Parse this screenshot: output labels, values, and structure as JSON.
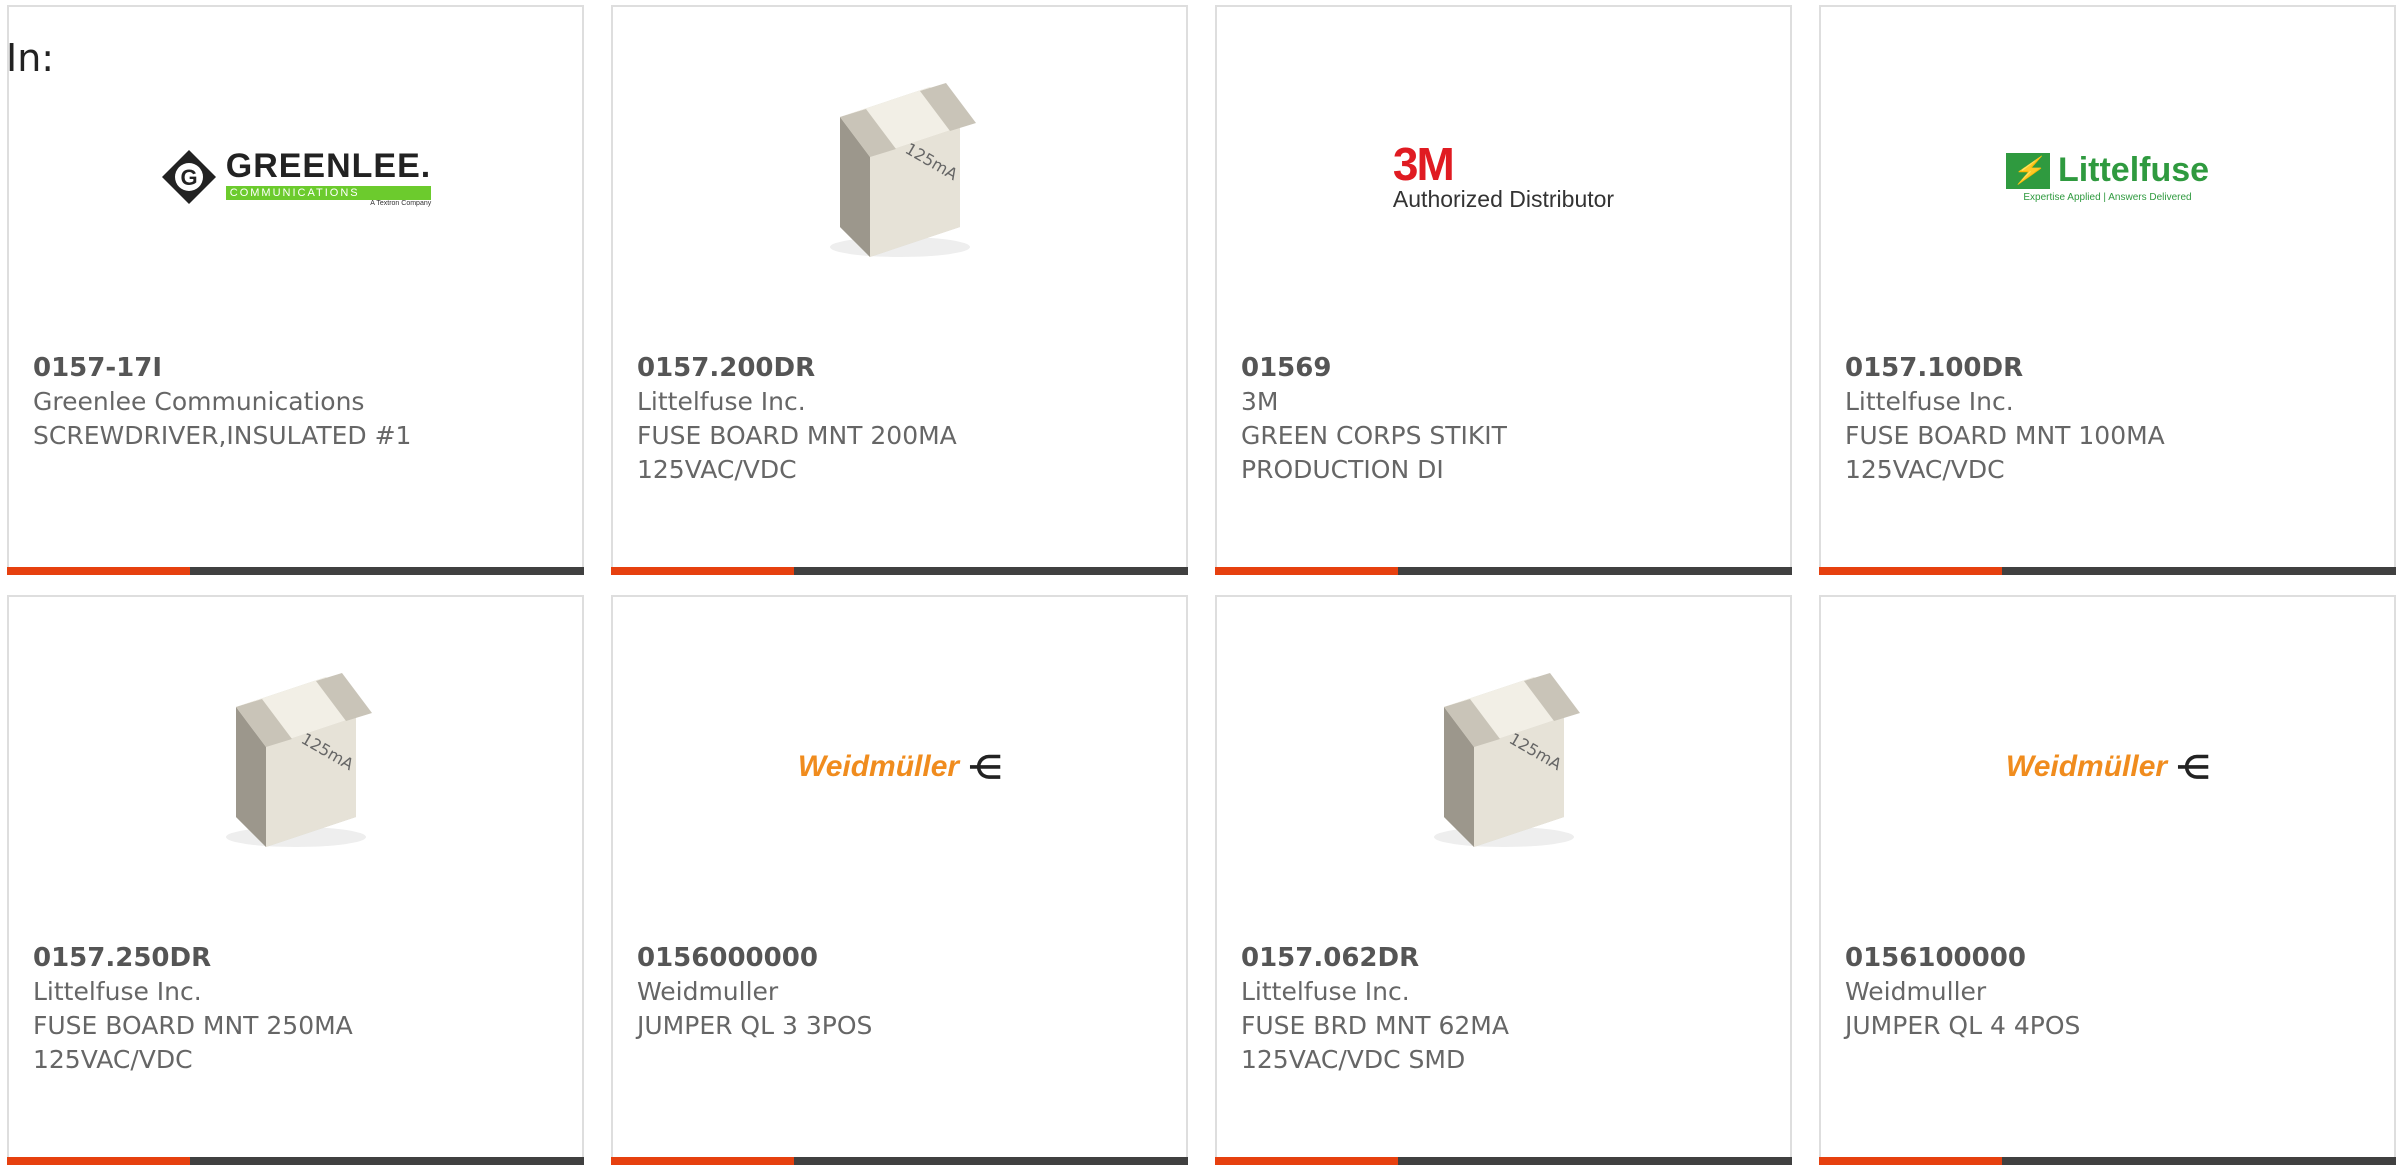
{
  "page": {
    "in_label": "In:"
  },
  "colors": {
    "accent": "#e6400f",
    "bar": "#404040",
    "border": "#dedede"
  },
  "products": [
    {
      "part": "0157-17I",
      "manufacturer": "Greenlee Communications",
      "desc1": "SCREWDRIVER,INSULATED #1",
      "desc2": "",
      "image": "greenlee-logo",
      "logo": {
        "name": "GREENLEE.",
        "sub": "COMMUNICATIONS",
        "small": "A Textron Company"
      }
    },
    {
      "part": "0157.200DR",
      "manufacturer": "Littelfuse Inc.",
      "desc1": "FUSE BOARD MNT 200MA",
      "desc2": "125VAC/VDC",
      "image": "fuse-photo",
      "logo": {
        "fuse_label": "125mA"
      }
    },
    {
      "part": "01569",
      "manufacturer": "3M",
      "desc1": "GREEN CORPS STIKIT",
      "desc2": "PRODUCTION DI",
      "image": "3m-logo",
      "logo": {
        "name": "3M",
        "sub": "Authorized Distributor"
      }
    },
    {
      "part": "0157.100DR",
      "manufacturer": "Littelfuse Inc.",
      "desc1": "FUSE BOARD MNT 100MA",
      "desc2": "125VAC/VDC",
      "image": "littelfuse-logo",
      "logo": {
        "name": "Littelfuse",
        "tag": "Expertise Applied | Answers Delivered"
      }
    },
    {
      "part": "0157.250DR",
      "manufacturer": "Littelfuse Inc.",
      "desc1": "FUSE BOARD MNT 250MA",
      "desc2": "125VAC/VDC",
      "image": "fuse-photo",
      "logo": {
        "fuse_label": "125mA"
      }
    },
    {
      "part": "0156000000",
      "manufacturer": "Weidmuller",
      "desc1": "JUMPER QL 3 3POS",
      "desc2": "",
      "image": "weidmuller-logo",
      "logo": {
        "name": "Weidmüller"
      }
    },
    {
      "part": "0157.062DR",
      "manufacturer": "Littelfuse Inc.",
      "desc1": "FUSE BRD MNT 62MA",
      "desc2": "125VAC/VDC SMD",
      "image": "fuse-photo",
      "logo": {
        "fuse_label": "125mA"
      }
    },
    {
      "part": "0156100000",
      "manufacturer": "Weidmuller",
      "desc1": "JUMPER QL 4 4POS",
      "desc2": "",
      "image": "weidmuller-logo",
      "logo": {
        "name": "Weidmüller"
      }
    }
  ]
}
